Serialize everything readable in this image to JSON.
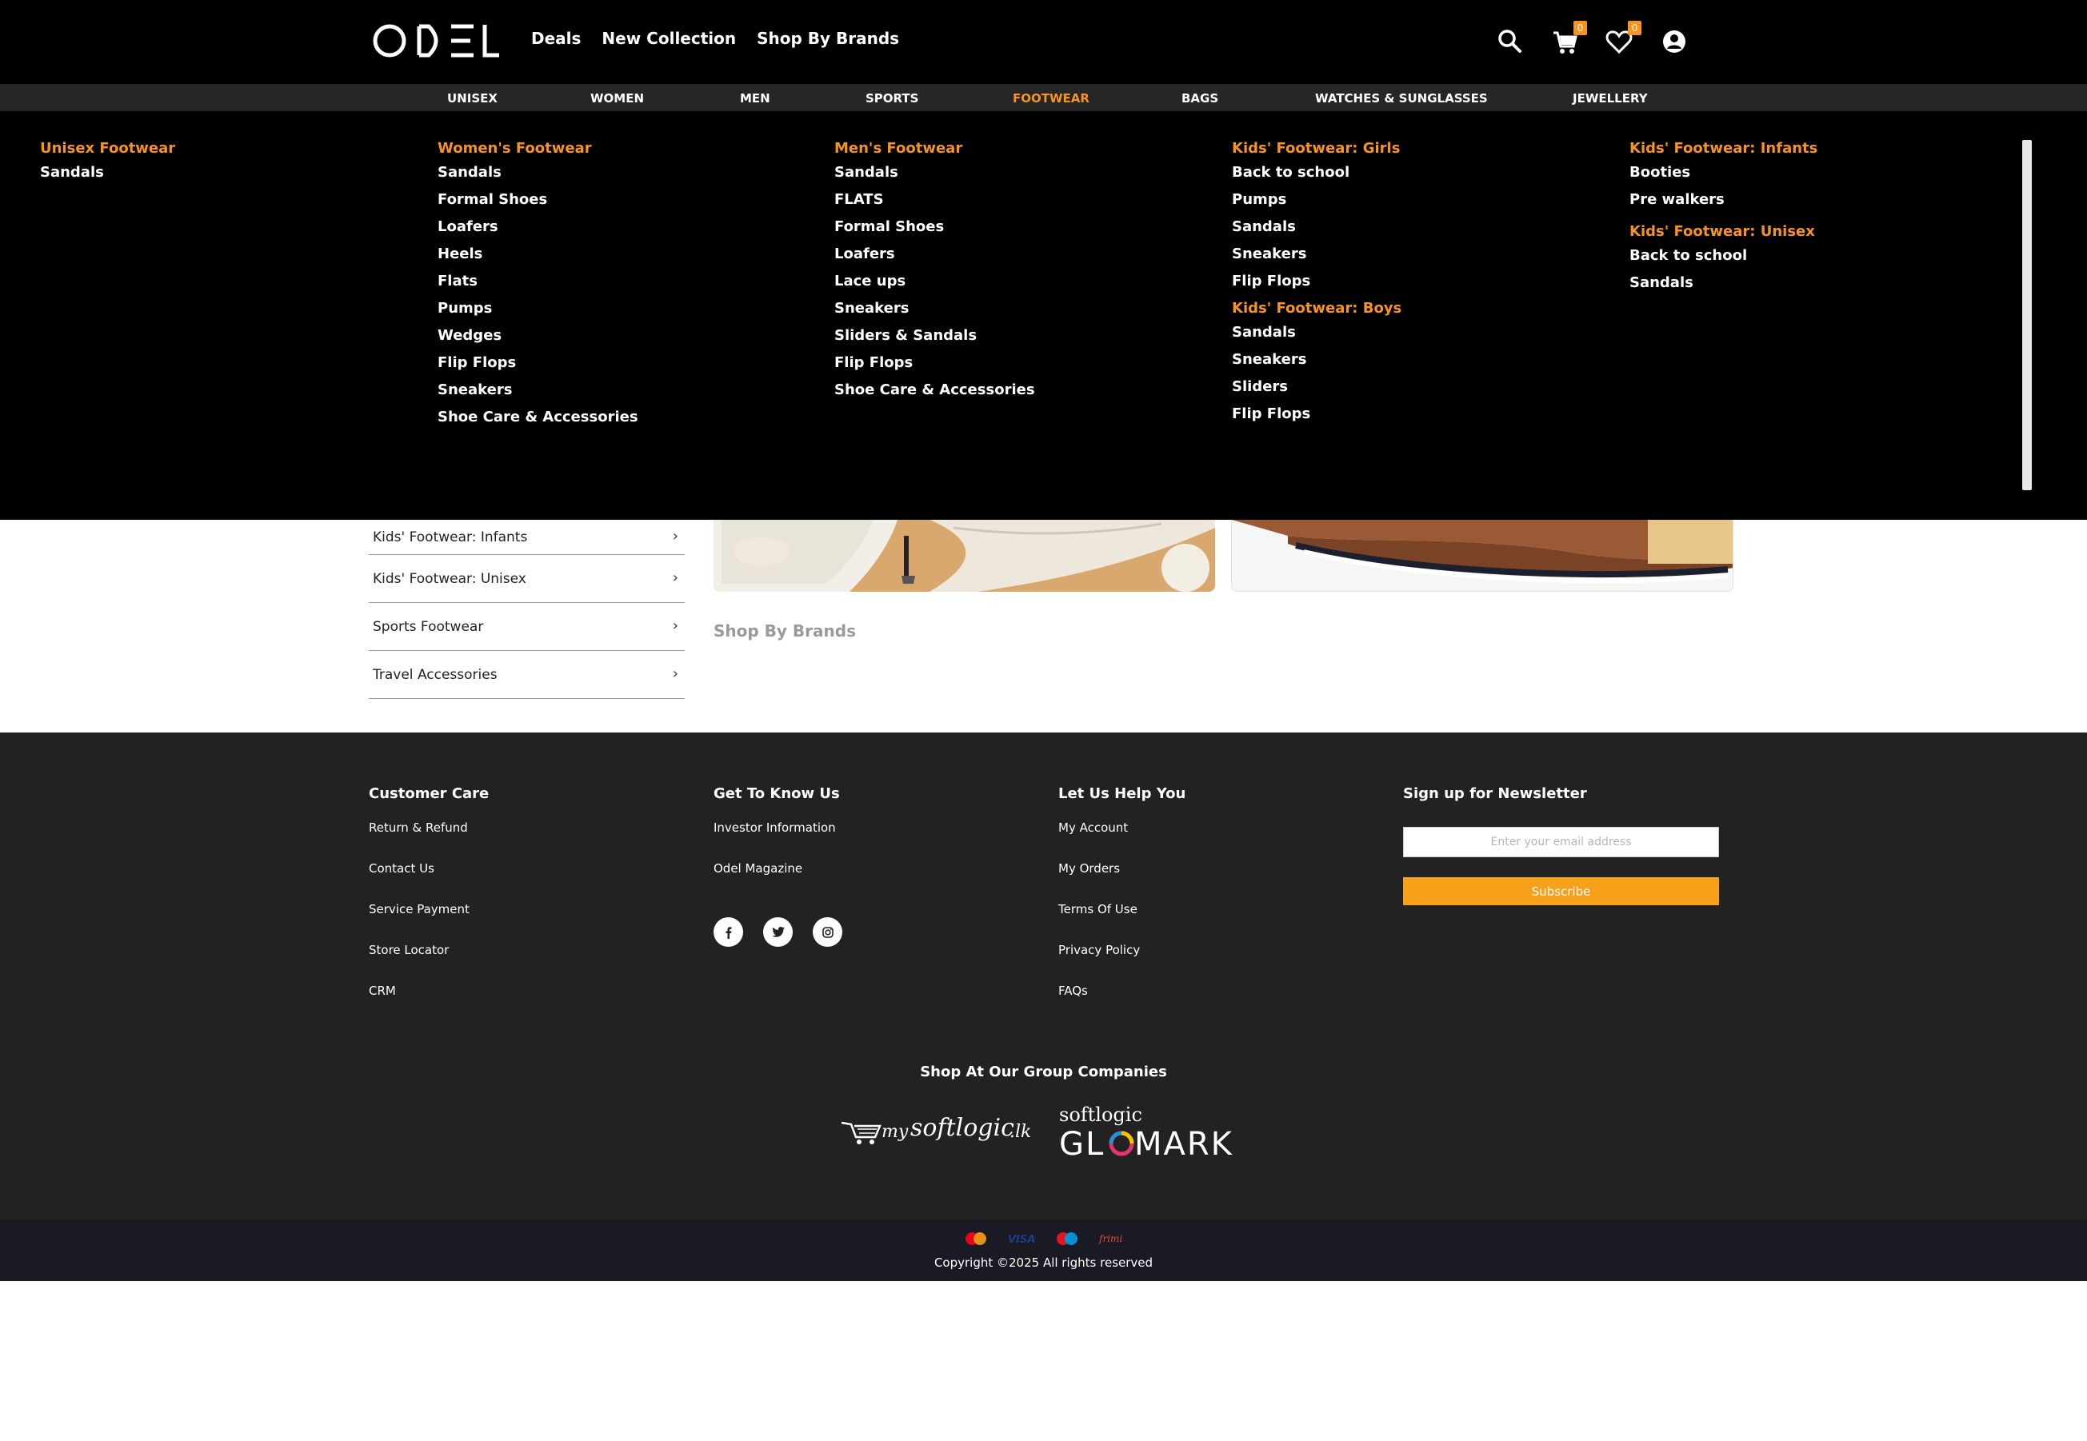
{
  "header": {
    "logo_text": "ODEL",
    "nav": [
      "Deals",
      "New Collection",
      "Shop By Brands"
    ],
    "cart_count": "0",
    "wishlist_count": "0",
    "icons": [
      "search-icon",
      "cart-icon",
      "heart-icon",
      "account-icon"
    ]
  },
  "categories": [
    "UNISEX",
    "WOMEN",
    "MEN",
    "SPORTS",
    "FOOTWEAR",
    "BAGS",
    "WATCHES & SUNGLASSES",
    "JEWELLERY"
  ],
  "active_category": "FOOTWEAR",
  "mega_menu": {
    "col1": [
      {
        "heading": "Unisex Footwear",
        "items": [
          "Sandals"
        ]
      }
    ],
    "col2": [
      {
        "heading": "Women's Footwear",
        "items": [
          "Sandals",
          "Formal Shoes",
          "Loafers",
          "Heels",
          "Flats",
          "Pumps",
          "Wedges",
          "Flip Flops",
          "Sneakers",
          "Shoe Care & Accessories"
        ]
      }
    ],
    "col3": [
      {
        "heading": "Men's Footwear",
        "items": [
          "Sandals",
          "FLATS",
          "Formal Shoes",
          "Loafers",
          "Lace ups",
          "Sneakers",
          "Sliders & Sandals",
          "Flip Flops",
          "Shoe Care & Accessories"
        ]
      }
    ],
    "col4": [
      {
        "heading": "Kids' Footwear: Girls",
        "items": [
          "Back to school",
          "Pumps",
          "Sandals",
          "Sneakers",
          "Flip Flops"
        ]
      },
      {
        "heading": "Kids' Footwear: Boys",
        "items": [
          "Sandals",
          "Sneakers",
          "Sliders",
          "Flip Flops"
        ]
      }
    ],
    "col5": [
      {
        "heading": "Kids' Footwear: Infants",
        "items": [
          "Booties",
          "Pre walkers"
        ]
      },
      {
        "heading": "Kids' Footwear: Unisex",
        "items": [
          "Back to school",
          "Sandals"
        ]
      }
    ]
  },
  "sidebar": {
    "items": [
      "Kids' Footwear: Infants",
      "Kids' Footwear: Unisex",
      "Sports Footwear",
      "Travel Accessories"
    ]
  },
  "main": {
    "shop_by_brands": "Shop By Brands"
  },
  "footer": {
    "customer_care": {
      "title": "Customer Care",
      "links": [
        "Return & Refund",
        "Contact Us",
        "Service Payment",
        "Store Locator",
        "CRM"
      ]
    },
    "get_to_know": {
      "title": "Get To Know Us",
      "links": [
        "Investor Information",
        "Odel Magazine"
      ]
    },
    "help": {
      "title": "Let Us Help You",
      "links": [
        "My Account",
        "My Orders",
        "Terms Of Use",
        "Privacy Policy",
        "FAQs"
      ]
    },
    "newsletter": {
      "title": "Sign up for Newsletter",
      "placeholder": "Enter your email address",
      "button": "Subscribe"
    },
    "social_icons": [
      "facebook-icon",
      "twitter-icon",
      "instagram-icon"
    ],
    "group_title": "Shop At Our Group Companies",
    "group_companies": [
      "mysoftlogic.lk",
      "softlogic GLOMARK"
    ],
    "payment_icons": [
      "mastercard-icon",
      "visa-icon",
      "maestro-icon",
      "frimi-icon"
    ],
    "copyright": "Copyright ©2025 All rights reserved"
  },
  "colors": {
    "accent": "#f7931e",
    "header_bg": "#000000",
    "footer_bg": "#222222"
  }
}
